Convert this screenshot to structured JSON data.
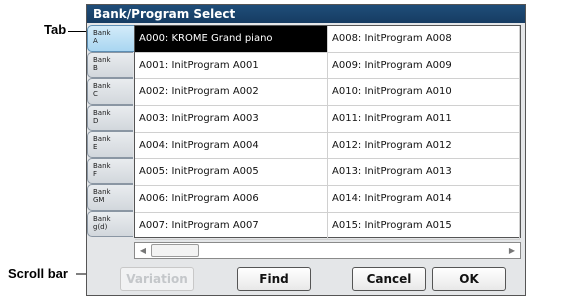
{
  "window": {
    "title": "Bank/Program Select"
  },
  "callouts": {
    "tab": "Tab",
    "scrollbar": "Scroll bar"
  },
  "tabs": [
    {
      "line1": "Bank",
      "line2": "A",
      "active": true
    },
    {
      "line1": "Bank",
      "line2": "B"
    },
    {
      "line1": "Bank",
      "line2": "C"
    },
    {
      "line1": "Bank",
      "line2": "D"
    },
    {
      "line1": "Bank",
      "line2": "E"
    },
    {
      "line1": "Bank",
      "line2": "F"
    },
    {
      "line1": "Bank",
      "line2": "GM"
    },
    {
      "line1": "Bank",
      "line2": "g(d)"
    }
  ],
  "programs": {
    "left": [
      "A000: KROME Grand piano",
      "A001: InitProgram A001",
      "A002: InitProgram A002",
      "A003: InitProgram A003",
      "A004: InitProgram A004",
      "A005: InitProgram A005",
      "A006: InitProgram A006",
      "A007: InitProgram A007"
    ],
    "right": [
      "A008: InitProgram A008",
      "A009: InitProgram A009",
      "A010: InitProgram A010",
      "A011: InitProgram A011",
      "A012: InitProgram A012",
      "A013: InitProgram A013",
      "A014: InitProgram A014",
      "A015: InitProgram A015"
    ],
    "selected": "A000: KROME Grand piano"
  },
  "icons": {
    "scroll_left": "arrow-left-icon",
    "scroll_right": "arrow-right-icon"
  },
  "buttons": {
    "variation": "Variation",
    "find": "Find",
    "cancel": "Cancel",
    "ok": "OK"
  }
}
